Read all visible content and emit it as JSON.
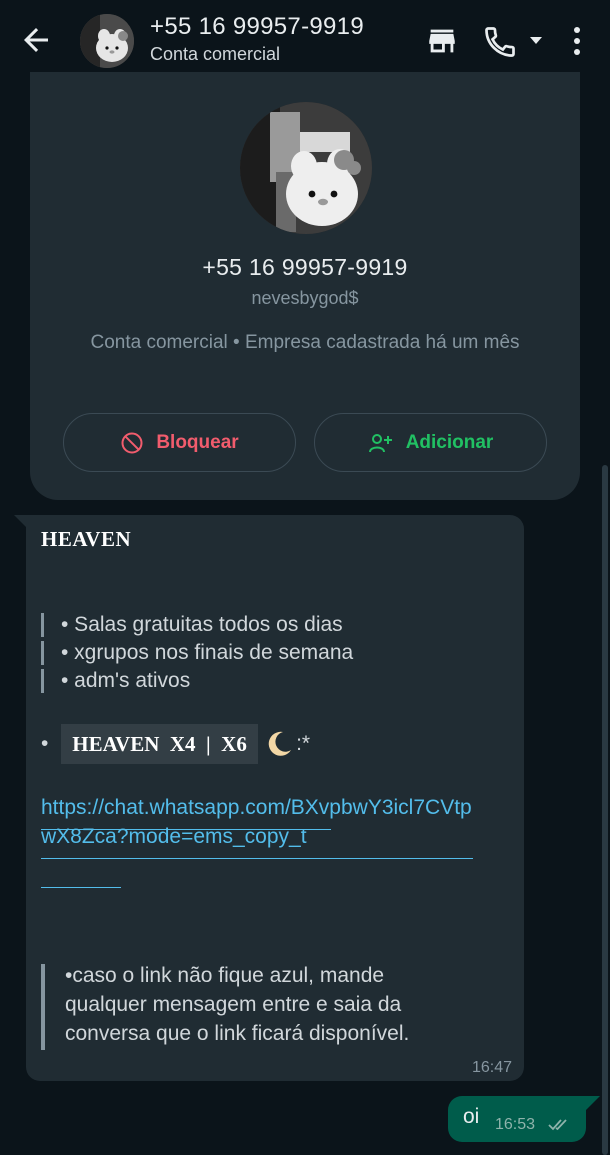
{
  "header": {
    "title": "+55 16 99957-9919",
    "subtitle": "Conta comercial",
    "icons": [
      "back-arrow-icon",
      "avatar",
      "store-icon",
      "phone-icon",
      "caret-down-icon",
      "more-vert-icon"
    ]
  },
  "profile": {
    "phone": "+55 16 99957-9919",
    "username": "nevesbygod$",
    "description": "Conta comercial • Empresa cadastrada há um mês",
    "block_label": "Bloquear",
    "add_label": "Adicionar",
    "block_color": "#f15c6d",
    "add_color": "#21c063"
  },
  "incoming_message": {
    "title": "HEAVEN",
    "quote_lines": [
      "• Salas gratuitas todos os dias",
      "• xgrupos nos finais de semana",
      "• adm's ativos"
    ],
    "heaven_bullet": "•",
    "heaven_code": " HEAVEN  X4  |  X6 ",
    "heaven_suffix": ":*",
    "link": "https://chat.whatsapp.com/BXvpbwY3icl7CVtpwX8Zca?mode=ems_copy_t",
    "note": "•caso o link não fique azul, mande qualquer mensagem entre e saia da conversa que o link ficará disponível.",
    "time": "16:47"
  },
  "outgoing_message": {
    "text": "oi",
    "time": "16:53",
    "status_icon": "double-check-icon"
  },
  "colors": {
    "background": "#0b141a",
    "bubble_in": "#202c33",
    "bubble_out": "#005c4b",
    "link": "#53bdeb"
  }
}
